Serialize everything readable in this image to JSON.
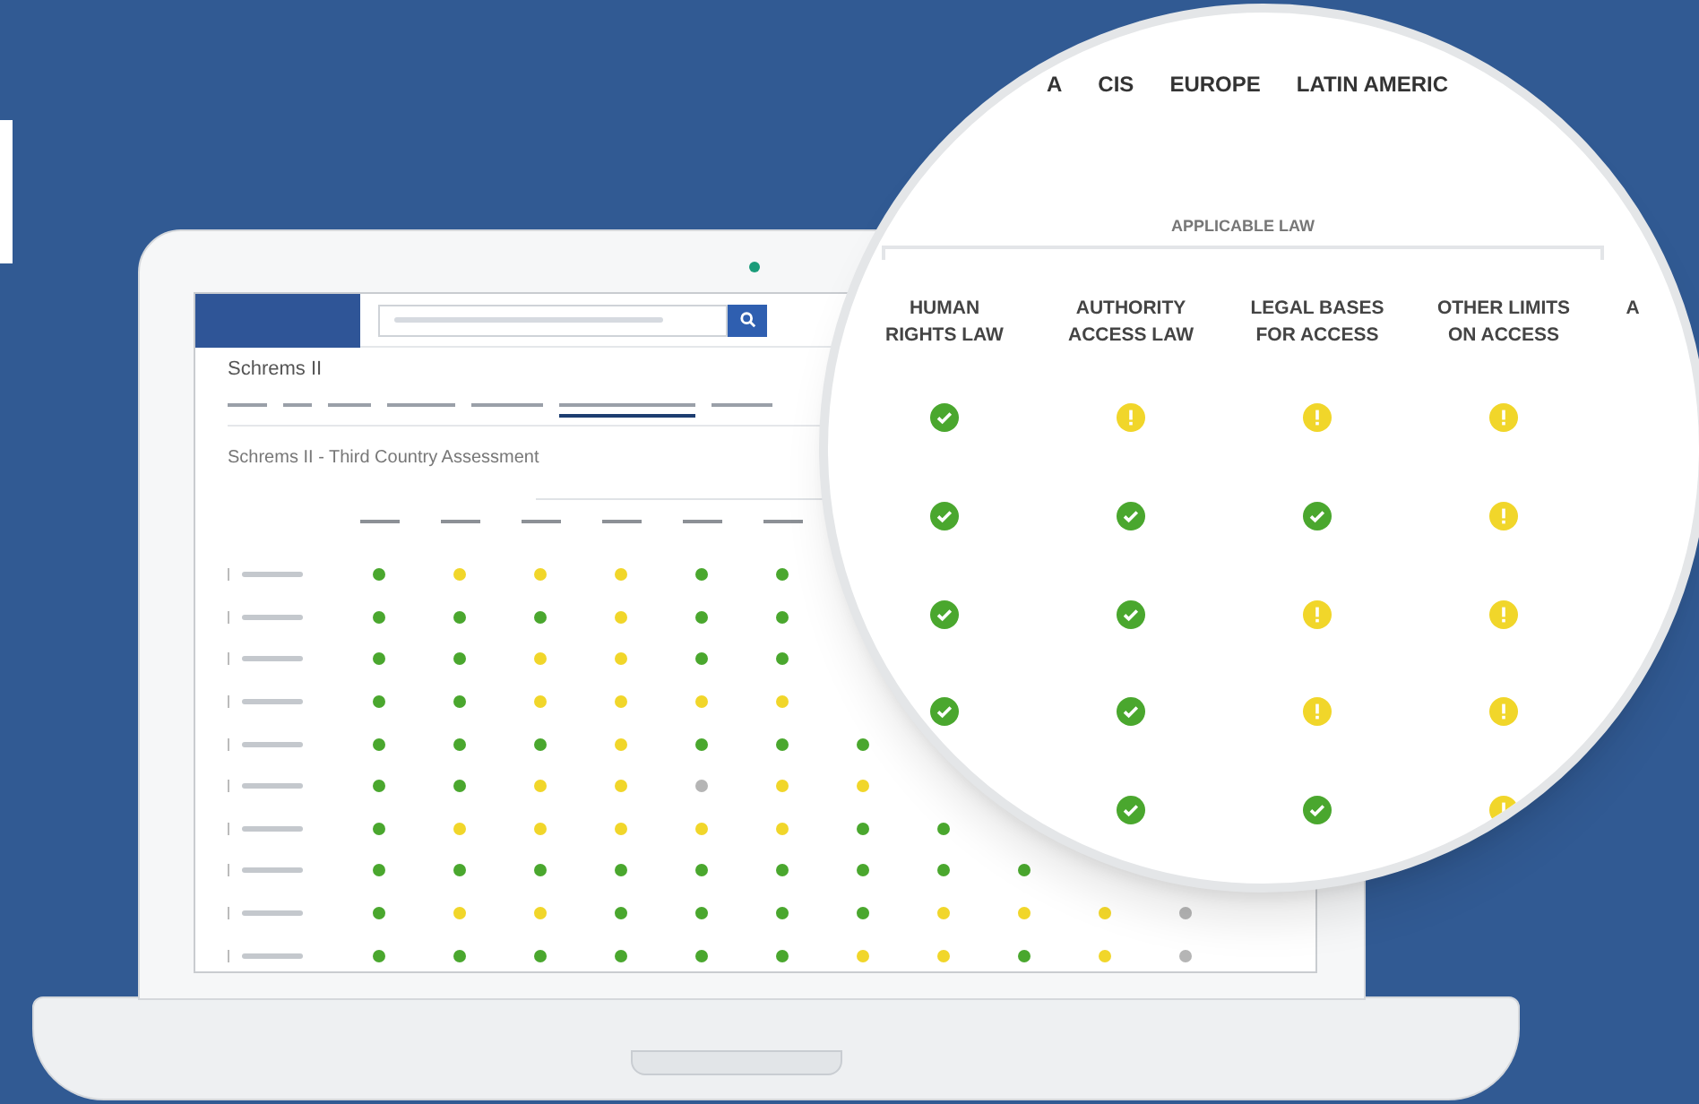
{
  "app": {
    "page_title": "Schrems II",
    "tabs": [
      {
        "selected": false
      },
      {
        "selected": false
      },
      {
        "selected": false
      },
      {
        "selected": false
      },
      {
        "selected": false
      },
      {
        "selected": true
      },
      {
        "selected": false
      }
    ],
    "section_title": "Schrems II - Third Country Assessment",
    "rows": [
      {
        "checked": false,
        "cells": [
          {
            "color": "#4aa72e"
          },
          {
            "color": "#f1d62a"
          },
          {
            "color": "#f1d62a"
          },
          {
            "color": "#f1d62a"
          },
          {
            "color": "#4aa72e"
          },
          {
            "color": "#4aa72e"
          }
        ]
      },
      {
        "checked": false,
        "cells": [
          {
            "color": "#4aa72e"
          },
          {
            "color": "#4aa72e"
          },
          {
            "color": "#4aa72e"
          },
          {
            "color": "#f1d62a"
          },
          {
            "color": "#4aa72e"
          },
          {
            "color": "#4aa72e"
          }
        ]
      },
      {
        "checked": false,
        "cells": [
          {
            "color": "#4aa72e"
          },
          {
            "color": "#4aa72e"
          },
          {
            "color": "#f1d62a"
          },
          {
            "color": "#f1d62a"
          },
          {
            "color": "#4aa72e"
          },
          {
            "color": "#4aa72e"
          }
        ]
      },
      {
        "checked": false,
        "cells": [
          {
            "color": "#4aa72e"
          },
          {
            "color": "#4aa72e"
          },
          {
            "color": "#f1d62a"
          },
          {
            "color": "#f1d62a"
          },
          {
            "color": "#f1d62a"
          },
          {
            "color": "#f1d62a"
          }
        ]
      },
      {
        "checked": false,
        "cells": [
          {
            "color": "#4aa72e"
          },
          {
            "color": "#4aa72e"
          },
          {
            "color": "#4aa72e"
          },
          {
            "color": "#f1d62a"
          },
          {
            "color": "#4aa72e"
          },
          {
            "color": "#4aa72e"
          },
          {
            "color": "#4aa72e"
          }
        ]
      },
      {
        "checked": false,
        "cells": [
          {
            "color": "#4aa72e"
          },
          {
            "color": "#4aa72e"
          },
          {
            "color": "#f1d62a"
          },
          {
            "color": "#f1d62a"
          },
          {
            "color": "#b5b5b5"
          },
          {
            "color": "#f1d62a"
          },
          {
            "color": "#f1d62a"
          }
        ]
      },
      {
        "checked": false,
        "cells": [
          {
            "color": "#4aa72e"
          },
          {
            "color": "#f1d62a"
          },
          {
            "color": "#f1d62a"
          },
          {
            "color": "#f1d62a"
          },
          {
            "color": "#f1d62a"
          },
          {
            "color": "#f1d62a"
          },
          {
            "color": "#4aa72e"
          },
          {
            "color": "#4aa72e"
          }
        ]
      },
      {
        "checked": false,
        "cells": [
          {
            "color": "#4aa72e"
          },
          {
            "color": "#4aa72e"
          },
          {
            "color": "#4aa72e"
          },
          {
            "color": "#4aa72e"
          },
          {
            "color": "#4aa72e"
          },
          {
            "color": "#4aa72e"
          },
          {
            "color": "#4aa72e"
          },
          {
            "color": "#4aa72e"
          },
          {
            "color": "#4aa72e"
          }
        ]
      },
      {
        "checked": false,
        "cells": [
          {
            "color": "#4aa72e"
          },
          {
            "color": "#f1d62a"
          },
          {
            "color": "#f1d62a"
          },
          {
            "color": "#4aa72e"
          },
          {
            "color": "#4aa72e"
          },
          {
            "color": "#4aa72e"
          },
          {
            "color": "#4aa72e"
          },
          {
            "color": "#f1d62a"
          },
          {
            "color": "#f1d62a"
          },
          {
            "color": "#f1d62a"
          },
          {
            "color": "#b5b5b5"
          }
        ]
      },
      {
        "checked": false,
        "cells": [
          {
            "color": "#4aa72e"
          },
          {
            "color": "#4aa72e"
          },
          {
            "color": "#4aa72e"
          },
          {
            "color": "#4aa72e"
          },
          {
            "color": "#4aa72e"
          },
          {
            "color": "#4aa72e"
          },
          {
            "color": "#f1d62a"
          },
          {
            "color": "#f1d62a"
          },
          {
            "color": "#4aa72e"
          },
          {
            "color": "#f1d62a"
          },
          {
            "color": "#b5b5b5"
          }
        ]
      }
    ]
  },
  "magnifier": {
    "regions": [
      "A",
      "CIS",
      "EUROPE",
      "LATIN AMERIC"
    ],
    "group_label": "APPLICABLE LAW",
    "columns": [
      "HUMAN\nRIGHTS LAW",
      "AUTHORITY\nACCESS LAW",
      "LEGAL BASES\nFOR ACCESS",
      "OTHER LIMITS\nON ACCESS",
      "A"
    ],
    "rows": [
      [
        {
          "kind": "ok"
        },
        {
          "kind": "warn"
        },
        {
          "kind": "warn"
        },
        {
          "kind": "warn"
        }
      ],
      [
        {
          "kind": "ok"
        },
        {
          "kind": "ok"
        },
        {
          "kind": "ok"
        },
        {
          "kind": "warn"
        }
      ],
      [
        {
          "kind": "ok"
        },
        {
          "kind": "ok"
        },
        {
          "kind": "warn"
        },
        {
          "kind": "warn"
        }
      ],
      [
        {
          "kind": "ok"
        },
        {
          "kind": "ok"
        },
        {
          "kind": "warn"
        },
        {
          "kind": "warn"
        }
      ],
      [
        {
          "kind": "empty"
        },
        {
          "kind": "ok"
        },
        {
          "kind": "ok"
        },
        {
          "kind": "warn"
        }
      ]
    ]
  }
}
